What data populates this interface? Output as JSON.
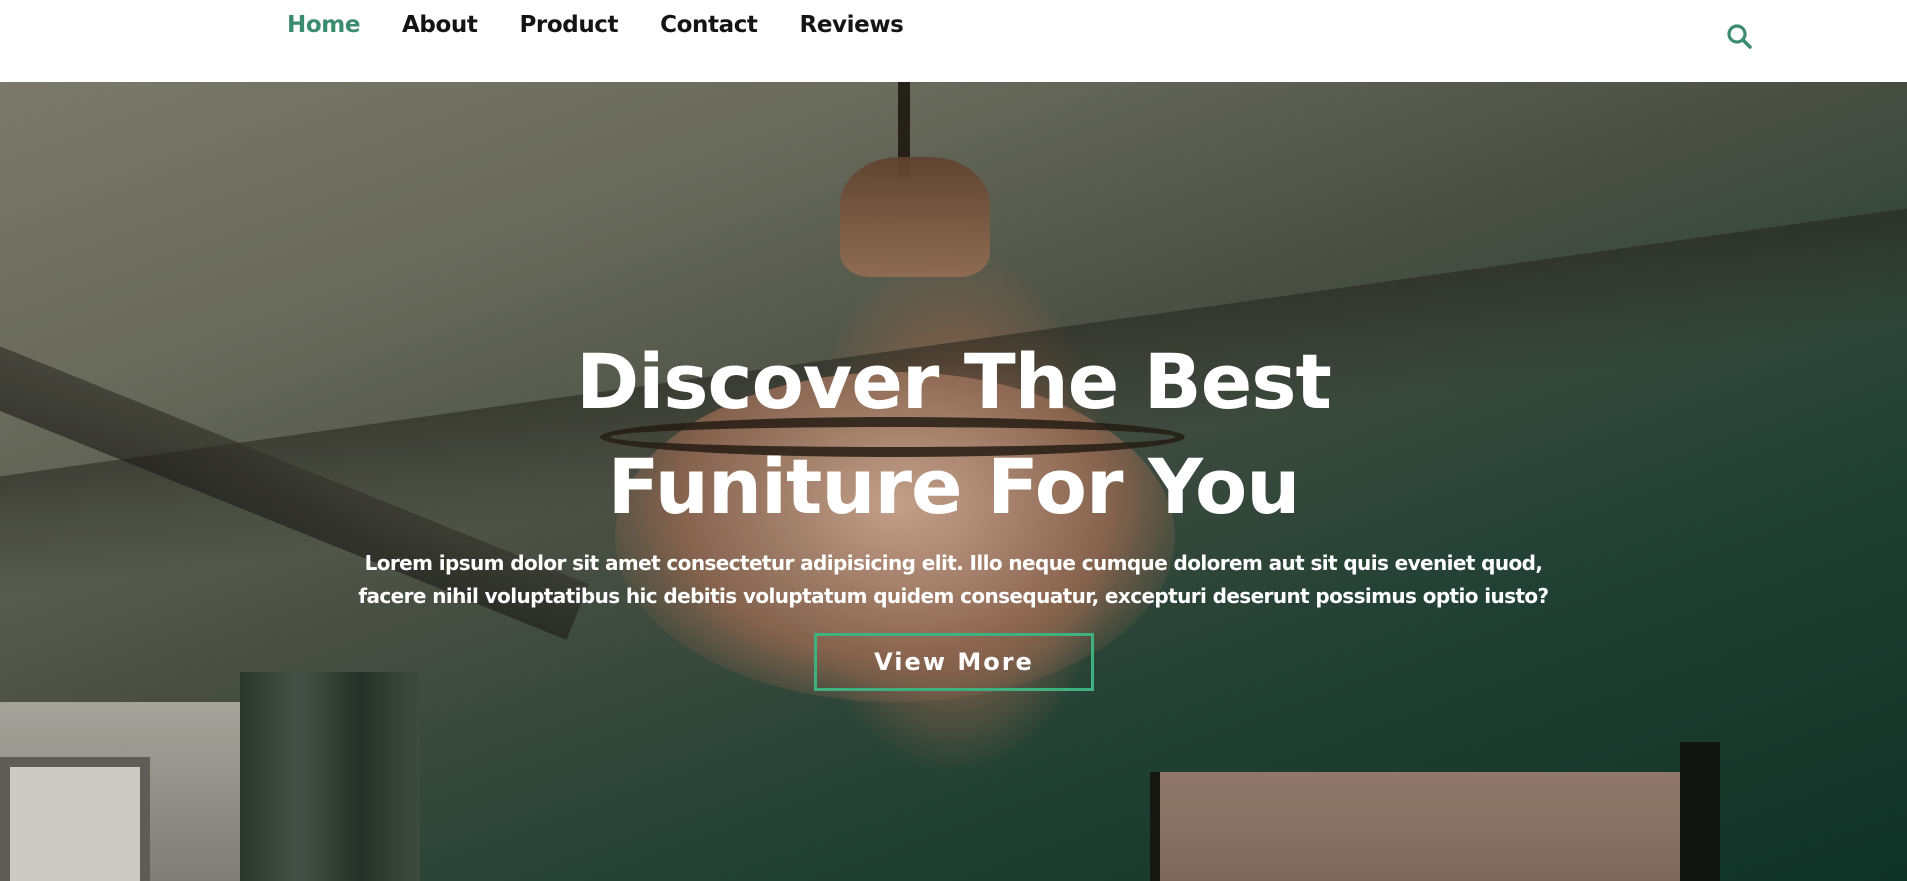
{
  "nav": {
    "items": [
      {
        "label": "Home",
        "active": true
      },
      {
        "label": "About",
        "active": false
      },
      {
        "label": "Product",
        "active": false
      },
      {
        "label": "Contact",
        "active": false
      },
      {
        "label": "Reviews",
        "active": false
      }
    ],
    "search_icon": "search-icon",
    "active_color": "#3b8c6e"
  },
  "hero": {
    "title_line1": "Discover The Best",
    "title_line2": "Funiture For You",
    "description": "Lorem ipsum dolor sit amet consectetur adipisicing elit. Illo neque cumque dolorem aut sit quis eveniet quod, facere nihil voluptatibus hic debitis voluptatum quidem consequatur, excepturi deserunt possimus optio iusto?",
    "button_label": "View More",
    "button_border_color": "#3fb07f"
  }
}
